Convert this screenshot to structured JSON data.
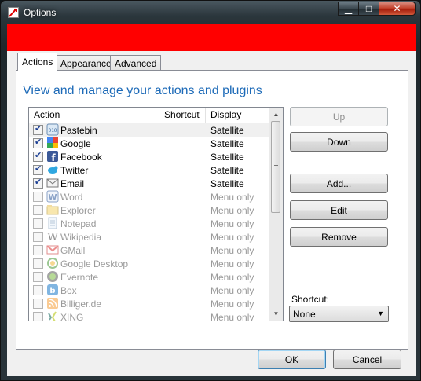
{
  "window": {
    "title": "Options",
    "min_glyph": "▁",
    "max_glyph": "□",
    "close_glyph": "✕"
  },
  "tabs": [
    {
      "label": "Actions",
      "active": true
    },
    {
      "label": "Appearance",
      "active": false
    },
    {
      "label": "Advanced",
      "active": false
    }
  ],
  "main": {
    "heading": "View and manage your actions and plugins",
    "columns": {
      "action": "Action",
      "shortcut": "Shortcut",
      "display": "Display"
    },
    "rows": [
      {
        "name": "Pastebin",
        "display": "Satellite",
        "checked": true,
        "icon": "pastebin-icon"
      },
      {
        "name": "Google",
        "display": "Satellite",
        "checked": true,
        "icon": "google-icon"
      },
      {
        "name": "Facebook",
        "display": "Satellite",
        "checked": true,
        "icon": "facebook-icon"
      },
      {
        "name": "Twitter",
        "display": "Satellite",
        "checked": true,
        "icon": "twitter-icon"
      },
      {
        "name": "Email",
        "display": "Satellite",
        "checked": true,
        "icon": "email-icon"
      },
      {
        "name": "Word",
        "display": "Menu only",
        "checked": false,
        "icon": "word-icon"
      },
      {
        "name": "Explorer",
        "display": "Menu only",
        "checked": false,
        "icon": "explorer-icon"
      },
      {
        "name": "Notepad",
        "display": "Menu only",
        "checked": false,
        "icon": "notepad-icon"
      },
      {
        "name": "Wikipedia",
        "display": "Menu only",
        "checked": false,
        "icon": "wikipedia-icon"
      },
      {
        "name": "GMail",
        "display": "Menu only",
        "checked": false,
        "icon": "gmail-icon"
      },
      {
        "name": "Google Desktop",
        "display": "Menu only",
        "checked": false,
        "icon": "google-desktop-icon"
      },
      {
        "name": "Evernote",
        "display": "Menu only",
        "checked": false,
        "icon": "evernote-icon"
      },
      {
        "name": "Box",
        "display": "Menu only",
        "checked": false,
        "icon": "box-icon"
      },
      {
        "name": "Billiger.de",
        "display": "Menu only",
        "checked": false,
        "icon": "rss-icon"
      },
      {
        "name": "XING",
        "display": "Menu only",
        "checked": false,
        "icon": "xing-icon"
      }
    ],
    "buttons": {
      "up": "Up",
      "down": "Down",
      "add": "Add...",
      "edit": "Edit",
      "remove": "Remove"
    },
    "shortcut": {
      "label": "Shortcut:",
      "value": "None"
    }
  },
  "footer": {
    "ok": "OK",
    "cancel": "Cancel"
  },
  "colors": {
    "banner": "#ff0000",
    "heading": "#1e6bb8"
  }
}
